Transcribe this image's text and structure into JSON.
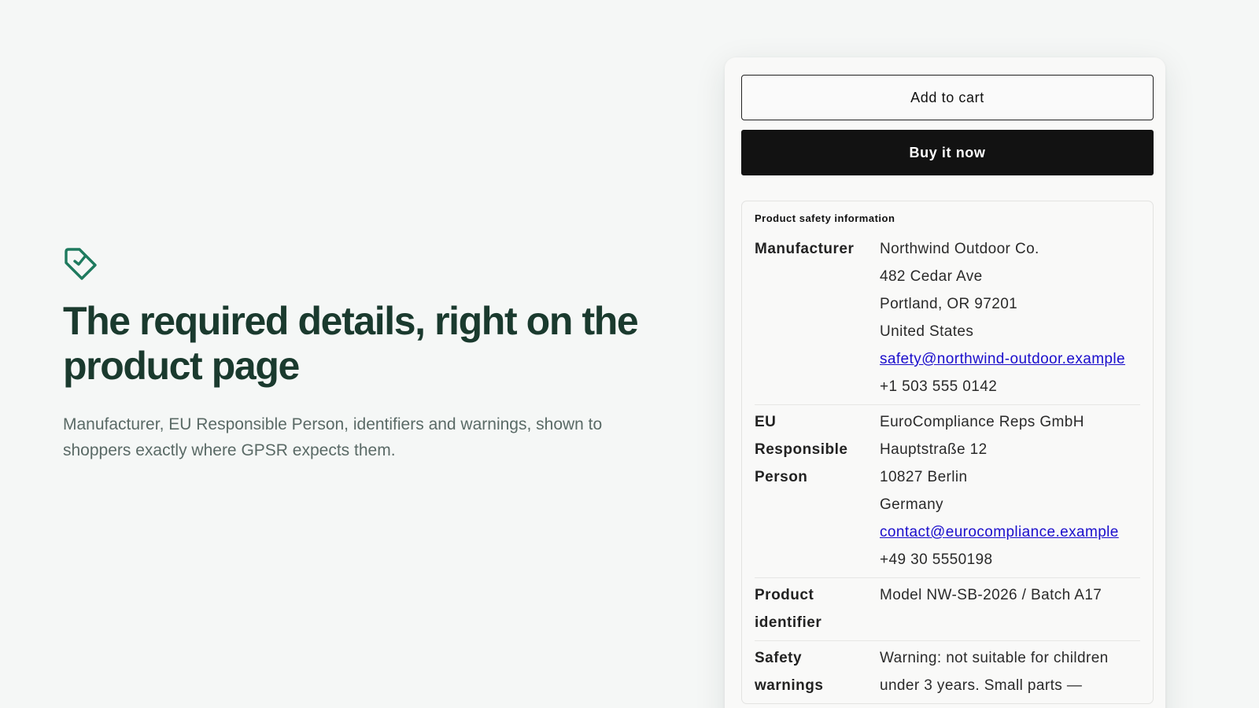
{
  "hero": {
    "icon": "tag-check-icon",
    "accent_color": "#1e7a5e",
    "title": "The required details, right on the product page",
    "subtitle": "Manufacturer, EU Responsible Person, identifiers and warnings, shown to shoppers exactly where GPSR expects them."
  },
  "card": {
    "add_to_cart_label": "Add to cart",
    "buy_now_label": "Buy it now",
    "safety": {
      "title": "Product safety information",
      "manufacturer": {
        "label": "Manufacturer",
        "name": "Northwind Outdoor Co.",
        "street": "482 Cedar Ave",
        "city": "Portland, OR 97201",
        "country": "United States",
        "email": "safety@northwind-outdoor.example",
        "phone": "+1 503 555 0142"
      },
      "eu_rep": {
        "label_line1": "EU",
        "label_line2": "Responsible",
        "label_line3": "Person",
        "name": "EuroCompliance Reps GmbH",
        "street": "Hauptstraße 12",
        "city": "10827 Berlin",
        "country": "Germany",
        "email": "contact@eurocompliance.example",
        "phone": "+49 30 5550198"
      },
      "identifier": {
        "label_line1": "Product",
        "label_line2": "identifier",
        "value": "Model NW-SB-2026 / Batch A17"
      },
      "warnings": {
        "label_line1": "Safety",
        "label_line2": "warnings",
        "value_line1": "Warning: not suitable for children",
        "value_line2": "under 3 years. Small parts —"
      }
    }
  }
}
